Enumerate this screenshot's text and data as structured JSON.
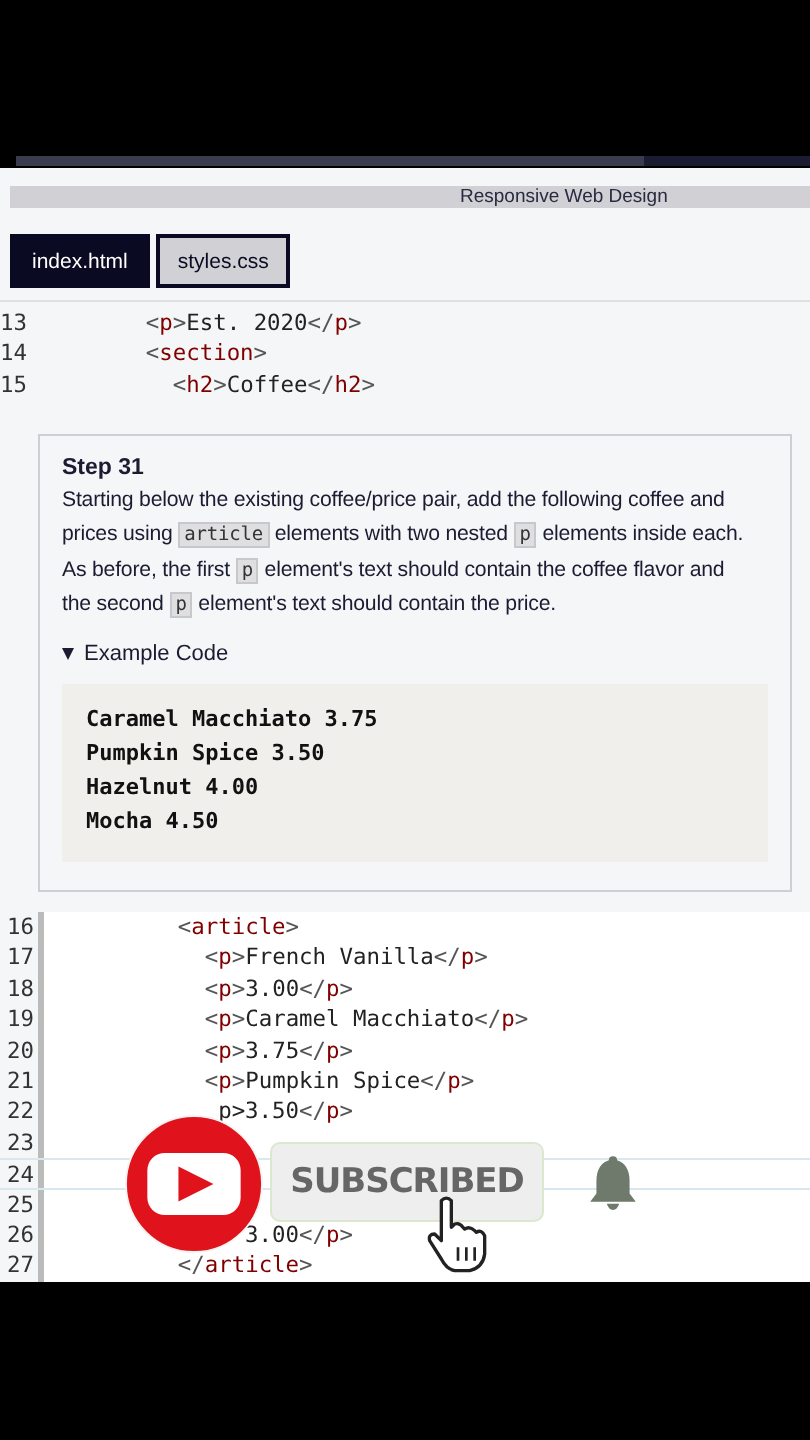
{
  "header": {
    "title": "Responsive Web Design"
  },
  "progress": {
    "level": 0.79
  },
  "tabs": [
    {
      "label": "index.html",
      "selected": true
    },
    {
      "label": "styles.css",
      "selected": false
    }
  ],
  "editor_top": {
    "lines": [
      {
        "number": "13",
        "code": "        <p>Est. 2020</p>"
      },
      {
        "number": "14",
        "code": "        <section>"
      },
      {
        "number": "15",
        "code": "          <h2>Coffee</h2>"
      }
    ]
  },
  "step": {
    "title": "Step 31",
    "description": [
      {
        "kind": "text",
        "text": "Starting below the existing coffee/price pair, add the following coffee and prices using "
      },
      {
        "kind": "code",
        "text": "article"
      },
      {
        "kind": "text",
        "text": " elements with two nested "
      },
      {
        "kind": "code",
        "text": "p"
      },
      {
        "kind": "text",
        "text": " elements inside each. As before, the first "
      },
      {
        "kind": "code",
        "text": "p"
      },
      {
        "kind": "text",
        "text": " element's text should contain the coffee flavor and the second "
      },
      {
        "kind": "code",
        "text": "p"
      },
      {
        "kind": "text",
        "text": " element's text should contain the price."
      }
    ],
    "example": {
      "label": "Example Code",
      "expanded": true,
      "lines": [
        "Caramel Macchiato 3.75",
        "Pumpkin Spice 3.50",
        "Hazelnut 4.00",
        "Mocha 4.50"
      ]
    }
  },
  "editor_bottom": {
    "lines": [
      {
        "number": "16",
        "code": "        <article>"
      },
      {
        "number": "17",
        "code": "          <p>French Vanilla</p>"
      },
      {
        "number": "18",
        "code": "          <p>3.00</p>"
      },
      {
        "number": "19",
        "code": "          <p>Caramel Macchiato</p>"
      },
      {
        "number": "20",
        "code": "          <p>3.75</p>"
      },
      {
        "number": "21",
        "code": "          <p>Pumpkin Spice</p>"
      },
      {
        "number": "22",
        "code": "           p>3.50</p>"
      },
      {
        "number": "23"
      },
      {
        "number": "24",
        "active": true
      },
      {
        "number": "25"
      },
      {
        "number": "26",
        "code": "             3.00</p>"
      },
      {
        "number": "27",
        "code": "        </article>"
      }
    ]
  },
  "overlay": {
    "button": "SUBSCRIBED"
  }
}
